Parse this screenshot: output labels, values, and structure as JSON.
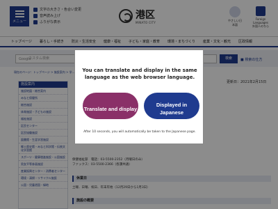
{
  "header": {
    "menu_label": "メニュー",
    "util_links": [
      "文字の大きさ・色合い変更",
      "音声読み上げ",
      "ふりがな表示"
    ],
    "logo_text": "港区",
    "logo_sub": "MINATO CITY",
    "icon_a_label": "やさしい日本語",
    "icon_b_label_1": "Foreign",
    "icon_b_label_2": "Languages",
    "icon_b_label_3": "外国人のちら"
  },
  "gnav": {
    "items": [
      "トップページ",
      "暮らし・手続き",
      "防災・生活安全",
      "健康・福祉",
      "子ども・家庭・教育",
      "環境・まちづくり",
      "産業・文化・観光",
      "区政情報"
    ]
  },
  "search": {
    "placeholder": "カスタム検索",
    "google_label": "Google",
    "button_label": "検索",
    "advanced_label": "■ 検索の仕方"
  },
  "content": {
    "breadcrumb": "現在のページ：トップページ > 施設案内 > 学...",
    "updated": "更新日：2021年2月15日",
    "sidebar_title": "施設案内",
    "sidebar_items": [
      "施設地図・総合案内",
      "みなと保健所",
      "総合施設",
      "体育施設・子どもの施設",
      "福祉施設",
      "区民センター",
      "区民協働施設",
      "図書館・生涯学習施設",
      "郷土歴史館・みなと科学館・伝統文化学習館",
      "スポーツ・健康増進施設・公園施設",
      "男女平等参画施設",
      "産業振興センター・消費者センター",
      "環境・清掃・リサイクル施設",
      "公園・児童遊園・緑地"
    ],
    "contact_line1": "保健福祉部　電話：03-5500-2352（月曜日のみ）",
    "contact_line2": "ファックス：03-5500-2366（各課共通）",
    "closed_heading": "休業日",
    "closed_text": "土曜、日曜、祝日、年末年始（12月29日から1月3日）",
    "facility_heading": "施設の概要"
  },
  "modal": {
    "message": "You can translate and display in the same language as the web browser language.",
    "translate_label": "Translate and display",
    "japanese_label": "Displayed in Japanese",
    "note": "After 10 seconds, you will automatically be taken to the Japanese page."
  }
}
